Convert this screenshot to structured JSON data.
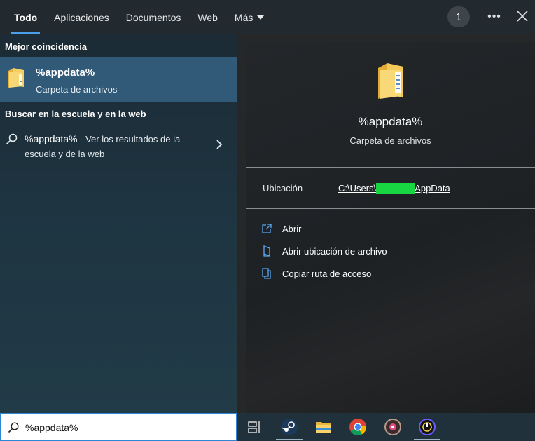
{
  "tabs": [
    {
      "label": "Todo",
      "active": true
    },
    {
      "label": "Aplicaciones"
    },
    {
      "label": "Documentos"
    },
    {
      "label": "Web"
    },
    {
      "label": "Más"
    }
  ],
  "header": {
    "badge_count": "1"
  },
  "left": {
    "best_match_title": "Mejor coincidencia",
    "best_match": {
      "name": "%appdata%",
      "type": "Carpeta de archivos",
      "icon": "folder-icon"
    },
    "web_section_title": "Buscar en la escuela y en la web",
    "web_result": {
      "query": "%appdata%",
      "suffix": " - Ver los resultados de la escuela y de la web"
    }
  },
  "preview": {
    "title": "%appdata%",
    "subtitle": "Carpeta de archivos",
    "location_label": "Ubicación",
    "location_prefix": "C:\\Users\\",
    "location_suffix": "AppData",
    "actions": [
      {
        "label": "Abrir",
        "icon": "open-icon"
      },
      {
        "label": "Abrir ubicación de archivo",
        "icon": "file-location-icon"
      },
      {
        "label": "Copiar ruta de acceso",
        "icon": "copy-path-icon"
      }
    ]
  },
  "taskbar": {
    "search_value": "%appdata%",
    "apps": [
      "task-view-icon",
      "steam-icon",
      "file-explorer-icon",
      "chrome-icon",
      "osu-icon",
      "app-icon"
    ]
  },
  "colors": {
    "accent": "#4a9fe8",
    "selection": "#305a78",
    "redaction": "#17d642"
  }
}
